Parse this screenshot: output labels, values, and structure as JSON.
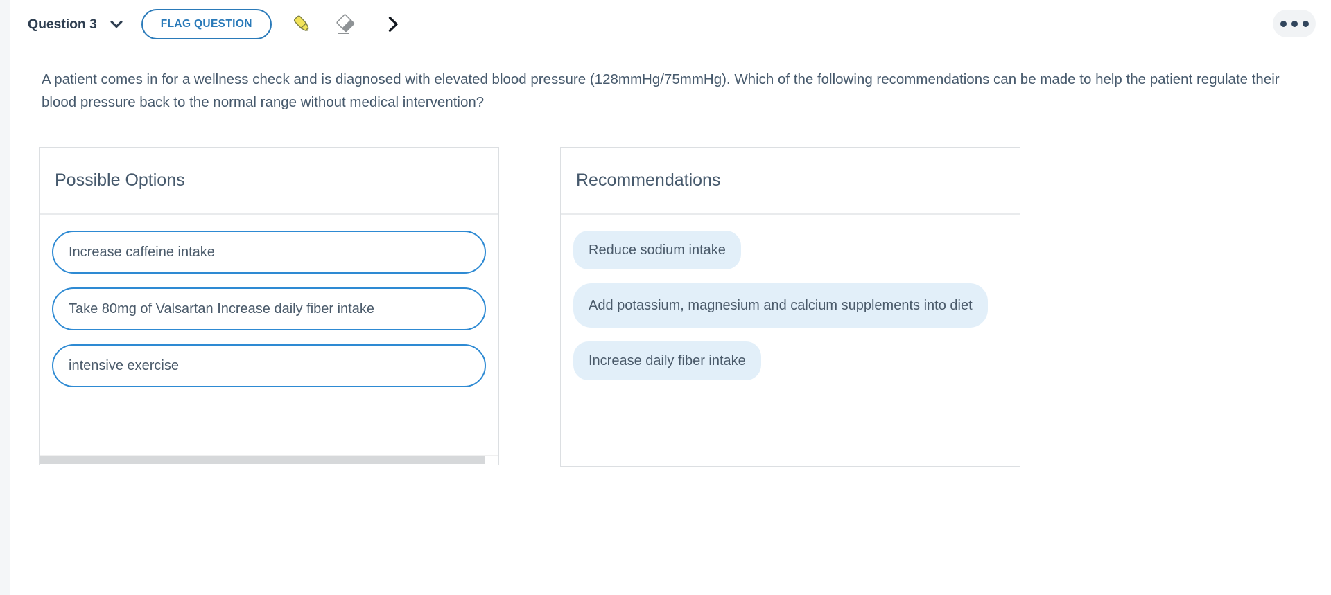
{
  "toolbar": {
    "question_label": "Question 3",
    "dropdown_icon": "chevron-down-icon",
    "flag_label": "FLAG QUESTION",
    "highlighter_icon": "highlighter-icon",
    "eraser_icon": "eraser-icon",
    "next_icon": "chevron-right-icon",
    "overflow_icon": "kebab-menu-icon",
    "accent_color": "#2a7ab9",
    "highlighter_color": "#f2e359",
    "eraser_color": "#8f9396"
  },
  "question": {
    "prompt": "A patient comes in for a wellness check and is diagnosed with elevated blood pressure (128mmHg/75mmHg). Which of the following recommendations can be made to help the patient regulate their blood pressure back to the normal range without medical intervention?"
  },
  "options_panel": {
    "title": "Possible Options",
    "items": [
      {
        "label": "Increase caffeine intake"
      },
      {
        "label": "Take 80mg of Valsartan Increase daily fiber intake"
      },
      {
        "label": "intensive exercise"
      }
    ],
    "border_color": "#2e8ad3",
    "has_horizontal_scrollbar": true
  },
  "recommendations_panel": {
    "title": "Recommendations",
    "items": [
      {
        "label": "Reduce sodium intake",
        "multiline": false
      },
      {
        "label": "Add potassium, magnesium and calcium supplements into diet",
        "multiline": true
      },
      {
        "label": "Increase daily fiber intake",
        "multiline": false
      }
    ],
    "chip_color": "#e2eff9"
  }
}
